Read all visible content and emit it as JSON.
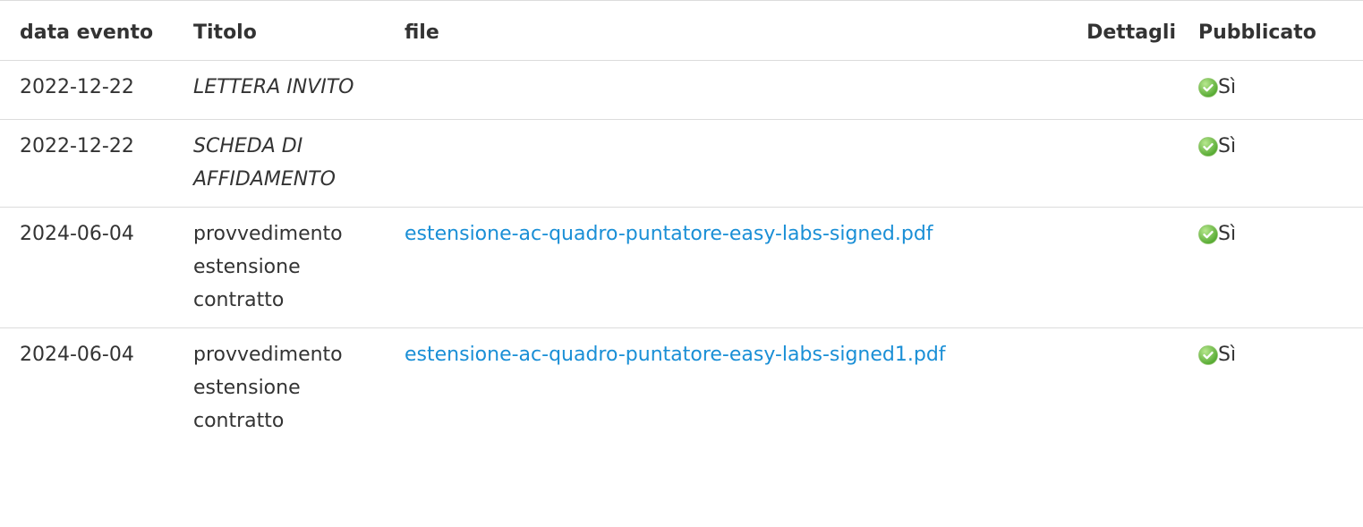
{
  "table": {
    "headers": {
      "date": "data evento",
      "title": "Titolo",
      "file": "file",
      "details": "Dettagli",
      "published": "Pubblicato"
    },
    "rows": [
      {
        "date": "2022-12-22",
        "title": "LETTERA INVITO",
        "title_italic": true,
        "file": "",
        "details": "",
        "published": "Sì"
      },
      {
        "date": "2022-12-22",
        "title": "SCHEDA DI AFFIDAMENTO",
        "title_italic": true,
        "file": "",
        "details": "",
        "published": "Sì"
      },
      {
        "date": "2024-06-04",
        "title": "provvedimento estensione contratto",
        "title_italic": false,
        "file": "estensione-ac-quadro-puntatore-easy-labs-signed.pdf",
        "details": "",
        "published": "Sì"
      },
      {
        "date": "2024-06-04",
        "title": "provvedimento estensione contratto",
        "title_italic": false,
        "file": "estensione-ac-quadro-puntatore-easy-labs-signed1.pdf",
        "details": "",
        "published": "Sì"
      }
    ],
    "published_icon": "check-circle-icon",
    "colors": {
      "link": "#1a8fd6",
      "check_icon": "#6cc04a",
      "text": "#333333",
      "border": "#dcdcdc"
    }
  }
}
